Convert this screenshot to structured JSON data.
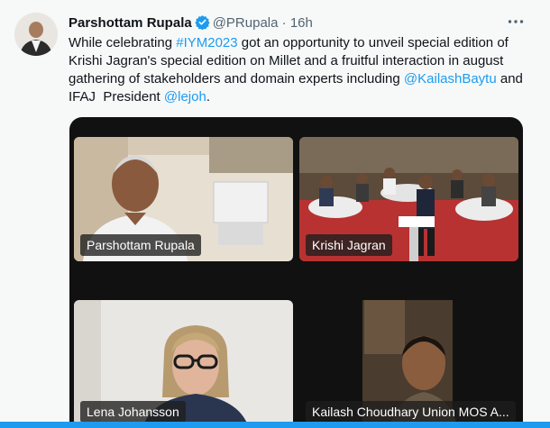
{
  "tweet": {
    "author_name": "Parshottam Rupala",
    "handle": "@PRupala",
    "separator": "·",
    "time": "16h",
    "more_icon": "ellipsis-icon",
    "verified_icon": "verified-badge-icon",
    "verified_color": "#1d9bf0",
    "text": {
      "l1_a": "While celebrating ",
      "hashtag": "#IYM2023",
      "l1_b": " got an opportunity to unveil special edition of",
      "l2": "Krishi Jagran's special edition on Millet and a fruitful interaction in august",
      "l3_a": "gathering of stakeholders and domain experts including ",
      "mention1": "@KailashBaytu",
      "l3_b": " and",
      "l4_a": "IFAJ  President ",
      "mention2": "@lejoh",
      "l4_b": "."
    },
    "link_color": "#1d9bf0"
  },
  "video_call": {
    "participants": [
      {
        "label": "Parshottam Rupala"
      },
      {
        "label": "Krishi Jagran"
      },
      {
        "label": "Lena Johansson"
      },
      {
        "label": "Kailash Choudhary Union MOS A..."
      }
    ]
  }
}
